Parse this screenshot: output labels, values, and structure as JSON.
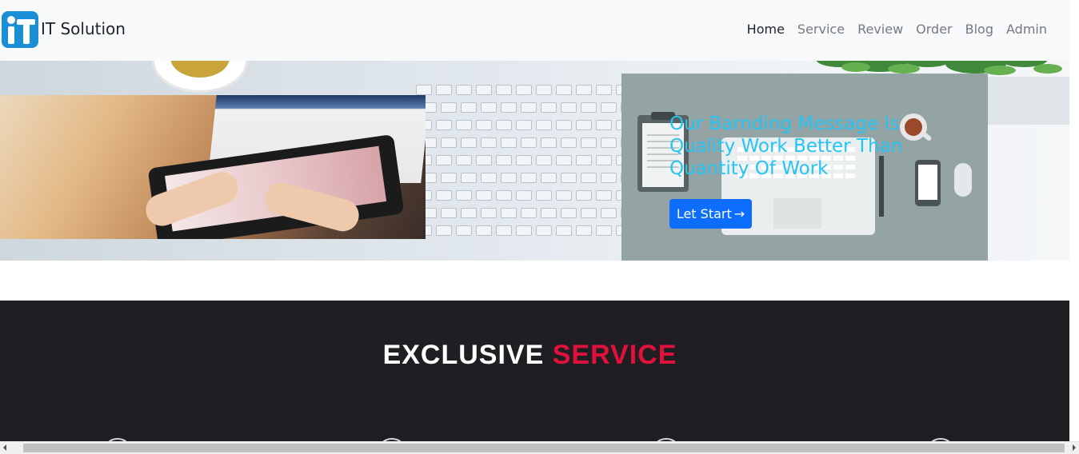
{
  "brand": {
    "name": "IT Solution",
    "logo_icon": "it-logo-icon",
    "logo_color": "#1a8fd6"
  },
  "nav": {
    "items": [
      {
        "label": "Home",
        "active": true
      },
      {
        "label": "Service",
        "active": false
      },
      {
        "label": "Review",
        "active": false
      },
      {
        "label": "Order",
        "active": false
      },
      {
        "label": "Blog",
        "active": false
      },
      {
        "label": "Admin",
        "active": false
      }
    ]
  },
  "hero": {
    "message": "Our Barnding Message Is Quality Work Better Than Quantity Of Work",
    "message_color": "#24c4f4",
    "cta_label": "Let Start",
    "cta_icon": "arrow-right-icon",
    "cta_color": "#0d6efd",
    "card_color": "#94a4a4"
  },
  "service": {
    "title_part1": "EXCLUSIVE",
    "title_part2": "SERVICE",
    "title_accent_color": "#e0123c",
    "background_color": "#201e23"
  }
}
